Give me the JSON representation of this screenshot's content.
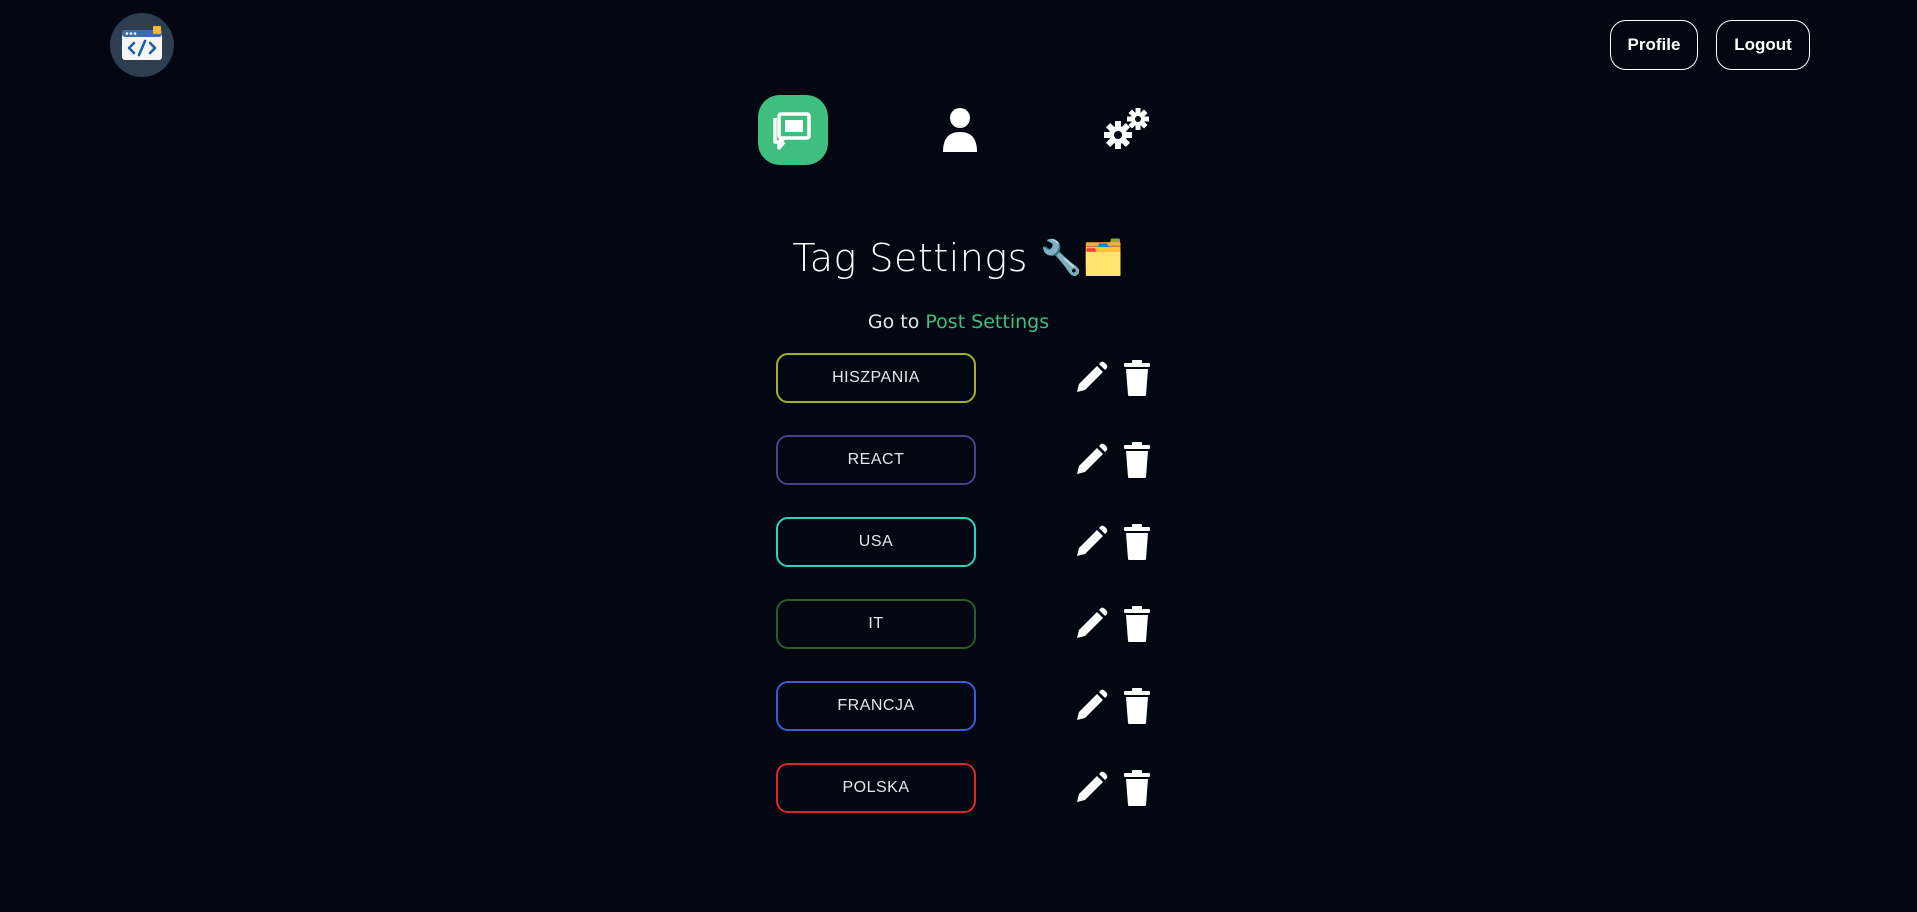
{
  "header": {
    "logo_icon": "code-window-icon",
    "profile_label": "Profile",
    "logout_label": "Logout"
  },
  "nav": {
    "items": [
      {
        "icon": "posts-icon",
        "active": true
      },
      {
        "icon": "user-icon",
        "active": false
      },
      {
        "icon": "gears-icon",
        "active": false
      }
    ],
    "accent_color": "#3fbf7f"
  },
  "main": {
    "title": "Tag Settings",
    "title_emoji": "🔧🗂️",
    "goto_prefix": "Go to",
    "goto_link": "Post Settings"
  },
  "tags": [
    {
      "label": "HISZPANIA",
      "color": "#a3b122"
    },
    {
      "label": "REACT",
      "color": "#4b3f8c"
    },
    {
      "label": "USA",
      "color": "#2dd4bf"
    },
    {
      "label": "IT",
      "color": "#2f5a26"
    },
    {
      "label": "FRANCJA",
      "color": "#3b5bdb"
    },
    {
      "label": "POLSKA",
      "color": "#dc2626"
    }
  ],
  "colors": {
    "background": "#030712",
    "text": "#ffffff"
  }
}
